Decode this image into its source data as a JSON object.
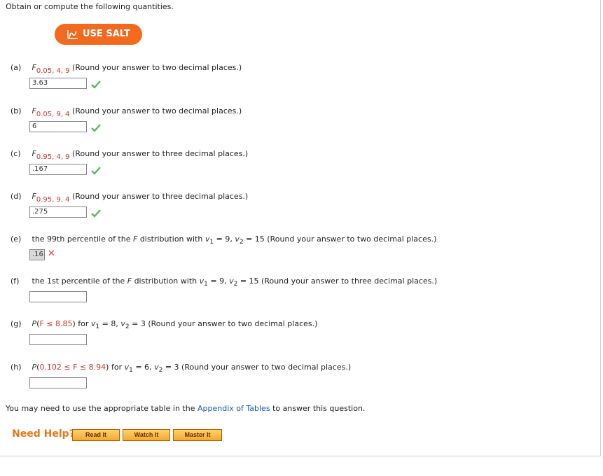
{
  "intro": "Obtain or compute the following quantities.",
  "salt_button": "USE SALT",
  "symbols": {
    "F": "F",
    "P": "P",
    "v": "v",
    "sub1": "1",
    "sub2": "2"
  },
  "questions": [
    {
      "label": "(a)",
      "sub": "0.05, 4, 9",
      "text": "(Round your answer to two decimal places.)",
      "answer": "3.63",
      "status": "correct"
    },
    {
      "label": "(b)",
      "sub": "0.05, 9, 4",
      "text": "(Round your answer to two decimal places.)",
      "answer": "6",
      "status": "correct"
    },
    {
      "label": "(c)",
      "sub": "0.95, 4, 9",
      "text": "(Round your answer to three decimal places.)",
      "answer": ".167",
      "status": "correct"
    },
    {
      "label": "(d)",
      "sub": "0.95, 9, 4",
      "text": "(Round your answer to three decimal places.)",
      "answer": ".275",
      "status": "correct"
    },
    {
      "label": "(e)",
      "pre": "the 99th percentile of the",
      "mid": "distribution with",
      "v1": "= 9,",
      "v2": "= 15 (Round your answer to two decimal places.)",
      "answer": ".16",
      "status": "incorrect"
    },
    {
      "label": "(f)",
      "pre": "the 1st percentile of the",
      "mid": "distribution with",
      "v1": "= 9,",
      "v2": "= 15 (Round your answer to three decimal places.)",
      "answer": "",
      "status": "blank"
    },
    {
      "label": "(g)",
      "expr_open": "(",
      "expr_red": "F ≤ 8.85",
      "expr_close": ")",
      "mid": "for",
      "v1": "= 8,",
      "v2": "= 3 (Round your answer to two decimal places.)",
      "answer": "",
      "status": "blank"
    },
    {
      "label": "(h)",
      "expr_open": "(",
      "expr_red": "0.102 ≤ F ≤ 8.94",
      "expr_close": ")",
      "mid": "for",
      "v1": "= 6,",
      "v2": "= 3 (Round your answer to two decimal places.)",
      "answer": "",
      "status": "blank"
    }
  ],
  "appendix": {
    "before": "You may need to use the appropriate table in the",
    "link": "Appendix of Tables",
    "after": "to answer this question."
  },
  "help": {
    "label": "Need Help?",
    "buttons": [
      "Read It",
      "Watch It",
      "Master It"
    ]
  },
  "colors": {
    "salt": "#f36a1f",
    "correct": "#5cb85c",
    "incorrect": "#e0393e",
    "link": "#1a5aa6",
    "param": "#c0392b"
  }
}
